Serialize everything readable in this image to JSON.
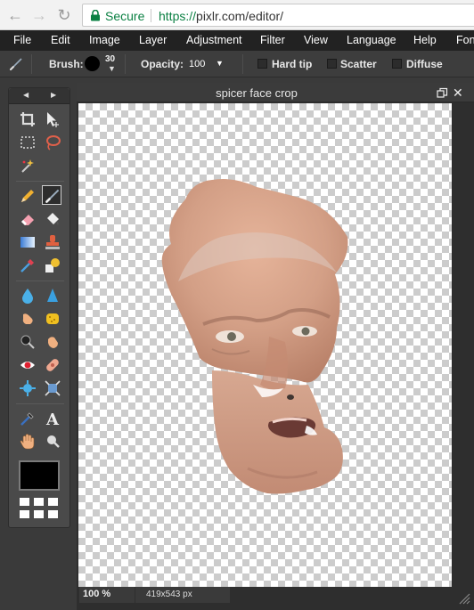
{
  "browser": {
    "secure_label": "Secure",
    "url_scheme": "https://",
    "url_host": "pixlr.com",
    "url_path": "/editor/"
  },
  "menu": [
    "File",
    "Edit",
    "Image",
    "Layer",
    "Adjustment",
    "Filter",
    "View",
    "Language",
    "Help",
    "Fon"
  ],
  "options": {
    "brush_label": "Brush:",
    "brush_size": "30",
    "opacity_label": "Opacity:",
    "opacity_value": "100",
    "hard_tip_label": "Hard tip",
    "scatter_label": "Scatter",
    "diffuse_label": "Diffuse"
  },
  "tools_panel": {
    "active_tool": "brush",
    "primary_color": "#000000"
  },
  "document": {
    "title": "spicer face crop",
    "zoom": "100",
    "zoom_unit": "%",
    "dimensions": "419x543 px"
  }
}
